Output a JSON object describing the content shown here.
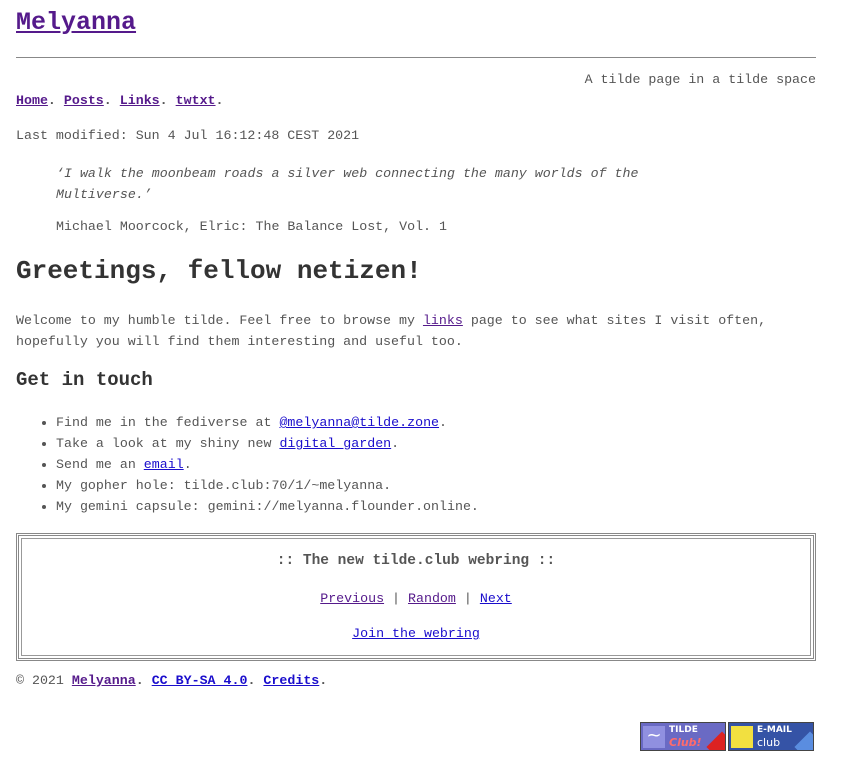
{
  "site": {
    "title": "Melyanna",
    "tagline": "A tilde page in a tilde space"
  },
  "nav": {
    "items": [
      "Home",
      "Posts",
      "Links",
      "twtxt"
    ],
    "sep": "."
  },
  "modified": "Last modified: Sun 4 Jul 16:12:48 CEST 2021",
  "quote": {
    "text": "‘I walk the moonbeam roads a silver web connecting the many worlds of the Multiverse.’",
    "cite": "Michael Moorcock, Elric: The Balance Lost, Vol. 1"
  },
  "greeting": {
    "heading": "Greetings, fellow netizen!",
    "before": "Welcome to my humble tilde. Feel free to browse my ",
    "link": "links",
    "after": " page to see what sites I visit often, hopefully you will find them interesting and useful too."
  },
  "contact": {
    "heading": "Get in touch",
    "item1_before": "Find me in the fediverse at ",
    "item1_link": "@melyanna@tilde.zone",
    "item2_before": "Take a look at my shiny new ",
    "item2_link": "digital garden",
    "item3_before": "Send me an ",
    "item3_link": "email",
    "item4": "My gopher hole: tilde.club:70/1/~melyanna.",
    "item5": "My gemini capsule: gemini://melyanna.flounder.online.",
    "period": "."
  },
  "webring": {
    "title": ":: The new tilde.club webring ::",
    "previous": "Previous",
    "random": "Random",
    "next": "Next",
    "sep": "|",
    "join": "Join the webring"
  },
  "footer": {
    "copy": "© 2021",
    "name": "Melyanna",
    "license": "CC BY-SA 4.0",
    "credits": "Credits",
    "sep": "."
  },
  "badges": {
    "tilde": {
      "line1": "TILDE",
      "line2": "Club!",
      "icon": "tilde-wave-icon"
    },
    "email": {
      "line1": "E-MAIL",
      "line2": "club",
      "icon": "yellow-square-icon"
    }
  }
}
